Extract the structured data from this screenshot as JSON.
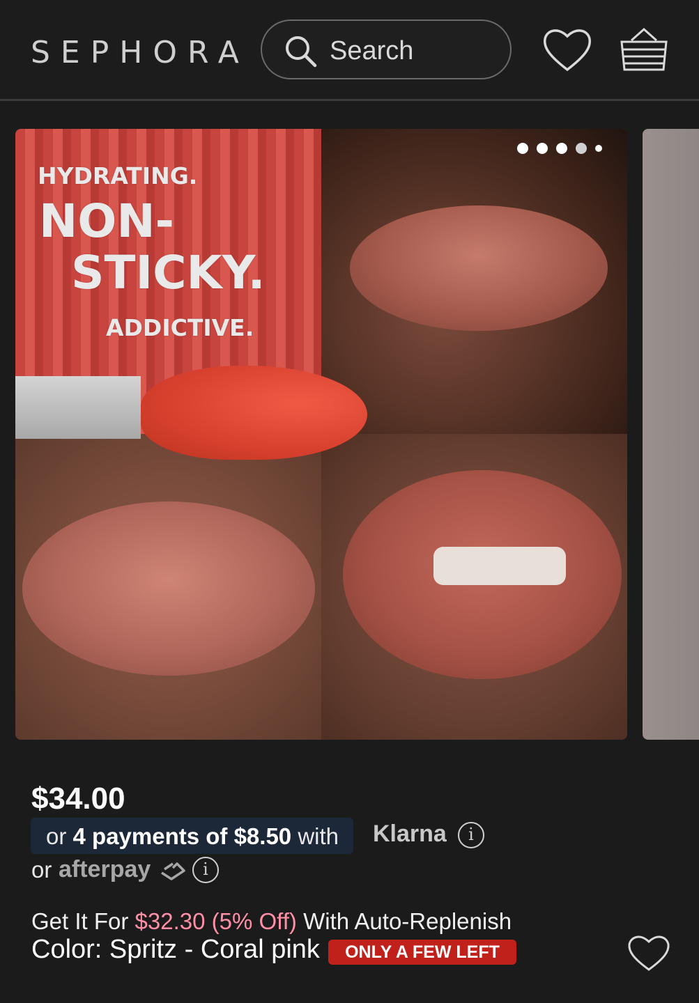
{
  "header": {
    "logo": "SEPHORA",
    "search_placeholder": "Search",
    "icons": [
      "search-icon",
      "heart-icon",
      "basket-icon"
    ]
  },
  "gallery": {
    "promo": {
      "line1": "HYDRATING.",
      "line2": "NON-",
      "line3": "STICKY.",
      "line4": "ADDICTIVE."
    },
    "dots_count": 5,
    "active_dot": 3
  },
  "product": {
    "price": "$34.00",
    "klarna": {
      "prefix": "or ",
      "bold": "4 payments of $8.50",
      "suffix": " with",
      "brand": "Klarna"
    },
    "afterpay": {
      "prefix": "or",
      "brand": "afterpay"
    },
    "auto_replenish": {
      "prefix": "Get It For ",
      "highlight": "$32.30 (5% Off)",
      "suffix": " With Auto-Replenish"
    },
    "color_line": "Color: Spritz - Coral pink",
    "badge": "ONLY A FEW LEFT"
  },
  "colors": {
    "background": "#1b1b1b",
    "accent_pink": "#ff8fa6",
    "badge_red": "#c0211b",
    "klarna_box": "#1c2838"
  }
}
